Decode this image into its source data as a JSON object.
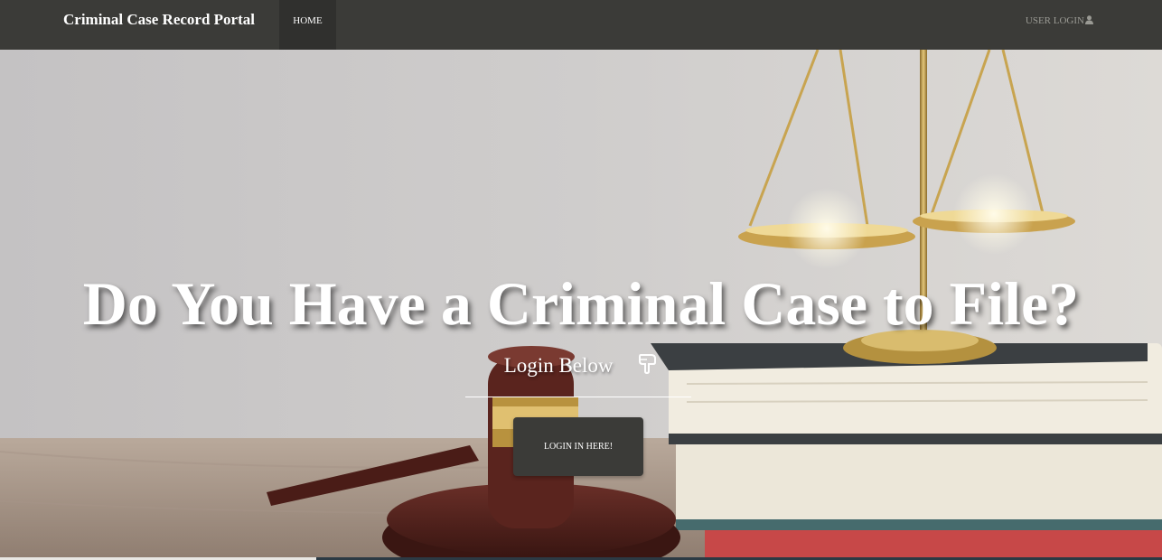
{
  "nav": {
    "brand": "Criminal Case Record Portal",
    "home": "HOME",
    "user_login": "USER LOGIN",
    "user_icon": "user-icon",
    "bg_color": "#3b3b38"
  },
  "hero": {
    "headline": "Do You Have a Criminal Case to File?",
    "subline": "Login Below",
    "pointer_icon": "hand-pointing-down-icon",
    "cta_label": "LOGIN IN HERE!",
    "background_image": "gavel-scales-books-photo"
  }
}
